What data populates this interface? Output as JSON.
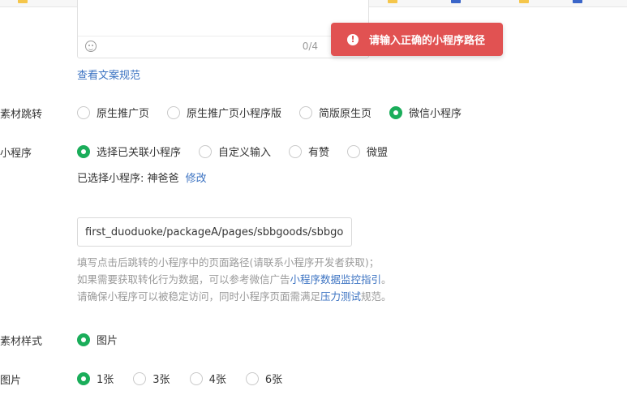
{
  "toast": {
    "message": "请输入正确的小程序路径"
  },
  "copy_field": {
    "count": "0/4",
    "guide_link": "查看文案规范"
  },
  "jump": {
    "label": "素材跳转",
    "options": [
      "原生推广页",
      "原生推广页小程序版",
      "简版原生页",
      "微信小程序"
    ],
    "selected": "微信小程序"
  },
  "mini_program": {
    "label": "小程序",
    "options": [
      "选择已关联小程序",
      "自定义输入",
      "有赞",
      "微盟"
    ],
    "selected": "选择已关联小程序",
    "selected_text": "已选择小程序: 神爸爸",
    "modify_link": "修改"
  },
  "path": {
    "value": "first_duoduoke/packageA/pages/sbbgoods/sbbgoods.h",
    "help_line1": "填写点击后跳转的小程序中的页面路径(请联系小程序开发者获取)；",
    "help_line2_pre": "如果需要获取转化行为数据，可以参考微信广告",
    "help_line2_link": "小程序数据监控指引",
    "help_line2_post": "。",
    "help_line3_pre": "请确保小程序可以被稳定访问，同时小程序页面需满足",
    "help_line3_link": "压力测试",
    "help_line3_post": "规范。"
  },
  "style": {
    "label": "素材样式",
    "options": [
      "图片"
    ],
    "selected": "图片"
  },
  "images": {
    "label": "图片",
    "options": [
      "1张",
      "3张",
      "4张",
      "6张"
    ],
    "selected": "1张"
  },
  "colors": {
    "accent_green": "#1aad5a",
    "link_blue": "#3c73c2",
    "toast_red": "#e15252"
  }
}
